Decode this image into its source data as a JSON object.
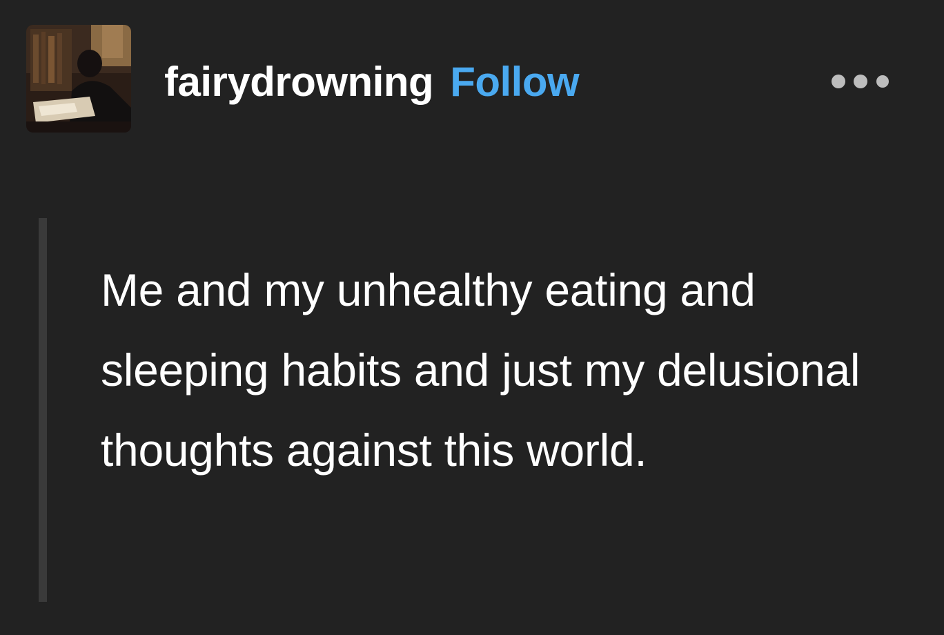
{
  "post": {
    "blog_name": "fairydrowning",
    "follow_label": "Follow",
    "more_options_icon": "ellipsis-horizontal-icon",
    "avatar_icon": "avatar-photo-icon",
    "quote_text": "Me and my unhealthy eating and sleeping habits and just my delusional thoughts against this world."
  },
  "colors": {
    "background": "#222222",
    "text": "#ffffff",
    "follow_accent": "#4aa9f0",
    "quote_bar": "#3a3a3a",
    "more_dots": "#bdbdbd"
  }
}
